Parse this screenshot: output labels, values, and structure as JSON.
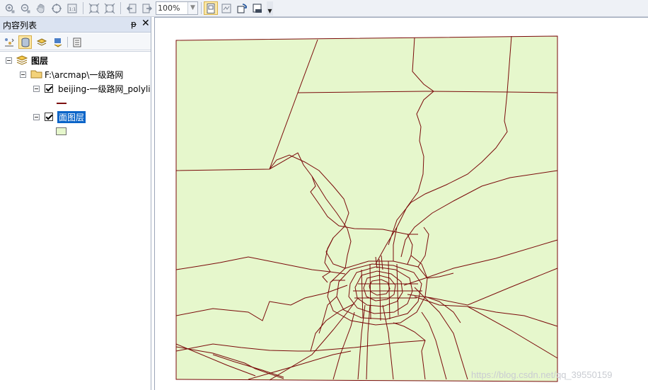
{
  "toolbar": {
    "zoom_value": "100%",
    "buttons": [
      "zoom-in-fixed-icon",
      "zoom-out-fixed-icon",
      "pan-icon",
      "full-extent-icon",
      "zoom-100-icon",
      "zoom-whole-page-icon",
      "zoom-whole-page2-icon",
      "back-extent-icon",
      "forward-extent-icon",
      "page-layout-icon",
      "data-view-icon",
      "refresh-icon",
      "focus-data-frame-icon"
    ]
  },
  "toc": {
    "title": "内容列表",
    "pin_glyph": "ᵽ",
    "close_glyph": "✕",
    "tools": [
      "list-by-drawing-order-icon",
      "list-by-source-icon",
      "list-by-visibility-icon",
      "list-by-selection-icon",
      "options-icon"
    ]
  },
  "tree": {
    "root_label": "图层",
    "folder_label": "F:\\arcmap\\一级路网",
    "layer1_label": "beijing-一级路网_polyli",
    "layer2_label": "面图层"
  },
  "colors": {
    "road": "#7a0a0a",
    "polygon_fill": "#e6f7cc",
    "selection": "#0a64c8"
  },
  "watermark": "https://blog.csdn.net/qq_39550159"
}
